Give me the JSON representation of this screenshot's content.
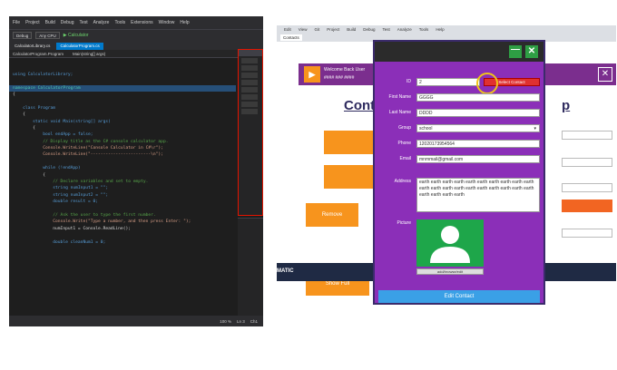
{
  "vs": {
    "menu": [
      "File",
      "Project",
      "Build",
      "Debug",
      "Test",
      "Analyze",
      "Tools",
      "Extensions",
      "Window",
      "Help"
    ],
    "config": "Debug",
    "platform": "Any CPU",
    "start_label": "Calculator",
    "tabs": [
      "CalculatorLibrary.cs",
      "CalculatorProgram.cs"
    ],
    "nav_left": "CalculatorProgram.Program",
    "nav_right": "Main(string[] args)",
    "code": [
      "",
      "",
      "using CalculatorLibrary;",
      "",
      "namespace CalculatorProgram",
      "{",
      "",
      "    class Program",
      "    {",
      "        static void Main(string[] args)",
      "        {",
      "            bool endApp = false;",
      "            // Display title as the C# console calculator app.",
      "            Console.WriteLine(\"Console Calculator in C#\\r\");",
      "            Console.WriteLine(\"------------------------\\n\");",
      "",
      "            while (!endApp)",
      "            {",
      "                // Declare variables and set to empty.",
      "                string numInput1 = \"\";",
      "                string numInput2 = \"\";",
      "                double result = 0;",
      "",
      "                // Ask the user to type the first number.",
      "                Console.Write(\"Type a number, and then press Enter: \");",
      "                numInput1 = Console.ReadLine();",
      "",
      "                double cleanNum1 = 0;"
    ],
    "zoom": "100 %",
    "status_line": "Ln 3",
    "status_ch": "Ch1"
  },
  "app": {
    "menu": [
      "Edit",
      "View",
      "Git",
      "Project",
      "Build",
      "Debug",
      "Test",
      "Analyze",
      "Tools",
      "Help"
    ],
    "tabs": [
      "Contacts"
    ],
    "main": {
      "welcome": "Welcome Back User",
      "user": "#### ### ####",
      "title_left": "Cont",
      "title_right": "p",
      "remove_label": "Remove",
      "show_full_label": "Show Full",
      "close_glyph": "✕",
      "footer": "MATIC"
    },
    "dialog": {
      "min_glyph": "—",
      "close_glyph": "✕",
      "labels": {
        "id": "ID",
        "first_name": "First Name",
        "last_name": "Last Name",
        "group": "Group",
        "phone": "Phone",
        "email": "Email",
        "address": "Address",
        "picture": "Picture"
      },
      "values": {
        "id": "2",
        "first_name": "GGGG",
        "last_name": "DDDD",
        "group": "school",
        "phone": "12020173954564",
        "email": "mnmmail@gmail.com",
        "address": "earth earth earth earth earth earth earth earth earth earth earth earth earth earth earth earth earth earth earth earth earth earth earth earth"
      },
      "select_contact_label": "Select Contact",
      "browse_label": "add/browse/edit",
      "edit_button_label": "Edit Contact"
    }
  }
}
